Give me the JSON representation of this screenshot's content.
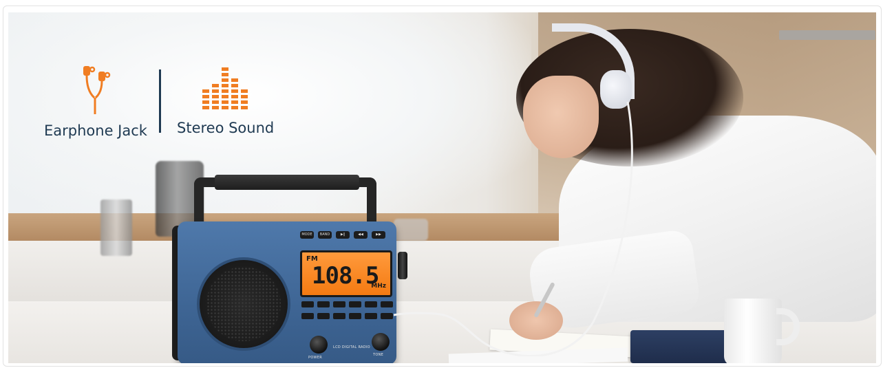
{
  "features": [
    {
      "label": "Earphone Jack",
      "icon": "earphone-icon",
      "color": "#f07d22"
    },
    {
      "label": "Stereo Sound",
      "icon": "equalizer-icon",
      "color": "#f07d22"
    }
  ],
  "label_color": "#1f3a52",
  "radio": {
    "lcd_band": "FM",
    "lcd_frequency": "108.5",
    "lcd_unit": "MHz",
    "top_buttons": [
      "MODE",
      "BAND",
      "▶‖",
      "◀◀",
      "▶▶"
    ],
    "left_knob_label": "POWER",
    "right_knob_label": "TONE",
    "model_text": "LCD DIGITAL RADIO",
    "body_color": "#44699a",
    "lcd_color": "#f58a22"
  }
}
